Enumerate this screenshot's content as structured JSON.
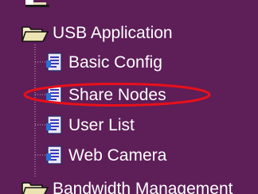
{
  "colors": {
    "background": "#5e1e58",
    "text": "#ffffff",
    "highlight_ring": "#e8101a",
    "tree_line": "#c9a9c4"
  },
  "tree": {
    "folders": [
      {
        "label": "USB Application",
        "icon": "folder-open-icon"
      },
      {
        "label": "Bandwidth Management",
        "icon": "folder-open-icon"
      }
    ],
    "items": [
      {
        "label": "Basic Config",
        "icon": "document-icon"
      },
      {
        "label": "Share Nodes",
        "icon": "document-icon"
      },
      {
        "label": "User List",
        "icon": "document-icon"
      },
      {
        "label": "Web Camera",
        "icon": "document-icon"
      }
    ]
  }
}
